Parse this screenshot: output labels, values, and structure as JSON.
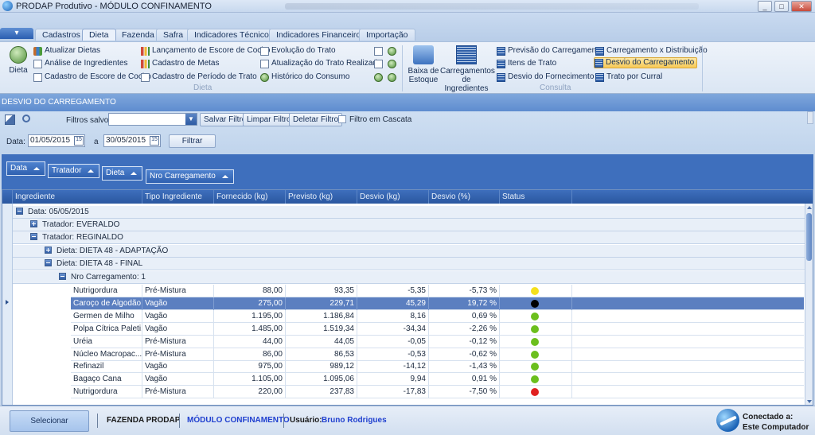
{
  "window": {
    "title": "PRODAP Produtivo - MÓDULO CONFINAMENTO",
    "controls": [
      "_",
      "□",
      "✕"
    ]
  },
  "tabs": [
    "Cadastros",
    "Dieta",
    "Fazenda",
    "Safra",
    "Indicadores Técnicos",
    "Indicadores Financeiros",
    "Importação"
  ],
  "ribbon": {
    "dieta_big": "Dieta",
    "col1": [
      "Atualizar Dietas",
      "Análise de Ingredientes",
      "Cadastro de Escore de Cocho"
    ],
    "col2": [
      "Lançamento de Escore de Cocho",
      "Cadastro de Metas",
      "Cadastro de Período de Trato"
    ],
    "col3": [
      "Evolução do Trato",
      "Atualização do Trato Realizado",
      "Histórico do Consumo"
    ],
    "dieta_group": "Dieta",
    "baixa_estoque": [
      "Baixa de",
      "Estoque"
    ],
    "carregamentos": [
      "Carregamentos",
      "de Ingredientes"
    ],
    "col5": [
      "Previsão do Carregamento",
      "Itens de Trato",
      "Desvio do Fornecimento"
    ],
    "col6": [
      "Carregamento x Distribuição",
      "Desvio do Carregamento",
      "Trato por Curral"
    ],
    "consulta_group": "Consulta"
  },
  "panel_title": "DESVIO DO CARREGAMENTO",
  "filters": {
    "saved_label": "Filtros salvos:",
    "saved_value": "",
    "save_btn": "Salvar Filtro",
    "clear_btn": "Limpar Filtro",
    "delete_btn": "Deletar Filtro",
    "cascade_label": "Filtro em Cascata",
    "date_label": "Data:",
    "date_from": "01/05/2015",
    "date_sep": "a",
    "date_to": "30/05/2015",
    "calendar_glyph": "15",
    "filter_btn": "Filtrar"
  },
  "group_chips": [
    "Data",
    "Tratador",
    "Dieta",
    "Nro Carregamento"
  ],
  "grid": {
    "headers": [
      "Ingrediente",
      "Tipo Ingrediente",
      "Fornecido (kg)",
      "Previsto (kg)",
      "Desvio (kg)",
      "Desvio (%)",
      "Status"
    ],
    "groups": [
      {
        "label": "Data: 05/05/2015"
      },
      {
        "label": "Tratador: EVERALDO"
      },
      {
        "label": "Tratador: REGINALDO"
      },
      {
        "label": "Dieta: DIETA 48 - ADAPTAÇÃO"
      },
      {
        "label": "Dieta: DIETA 48 - FINAL"
      },
      {
        "label": "Nro Carregamento: 1"
      }
    ],
    "rows": [
      {
        "ingrediente": "Nutrigordura",
        "tipo": "Pré-Mistura",
        "fornecido": "88,00",
        "previsto": "93,35",
        "desvio_kg": "-5,35",
        "desvio_pct": "-5,73 %",
        "status": "#f5e01c"
      },
      {
        "ingrediente": "Caroço de Algodão",
        "tipo": "Vagão",
        "fornecido": "275,00",
        "previsto": "229,71",
        "desvio_kg": "45,29",
        "desvio_pct": "19,72 %",
        "status": "#000000"
      },
      {
        "ingrediente": "Germen de Milho",
        "tipo": "Vagão",
        "fornecido": "1.195,00",
        "previsto": "1.186,84",
        "desvio_kg": "8,16",
        "desvio_pct": "0,69 %",
        "status": "#6bbf1d"
      },
      {
        "ingrediente": "Polpa Cítrica Paleti...",
        "tipo": "Vagão",
        "fornecido": "1.485,00",
        "previsto": "1.519,34",
        "desvio_kg": "-34,34",
        "desvio_pct": "-2,26 %",
        "status": "#6bbf1d"
      },
      {
        "ingrediente": "Uréia",
        "tipo": "Pré-Mistura",
        "fornecido": "44,00",
        "previsto": "44,05",
        "desvio_kg": "-0,05",
        "desvio_pct": "-0,12 %",
        "status": "#6bbf1d"
      },
      {
        "ingrediente": "Núcleo Macropac...",
        "tipo": "Pré-Mistura",
        "fornecido": "86,00",
        "previsto": "86,53",
        "desvio_kg": "-0,53",
        "desvio_pct": "-0,62 %",
        "status": "#6bbf1d"
      },
      {
        "ingrediente": "Refinazil",
        "tipo": "Vagão",
        "fornecido": "975,00",
        "previsto": "989,12",
        "desvio_kg": "-14,12",
        "desvio_pct": "-1,43 %",
        "status": "#6bbf1d"
      },
      {
        "ingrediente": "Bagaço Cana",
        "tipo": "Vagão",
        "fornecido": "1.105,00",
        "previsto": "1.095,06",
        "desvio_kg": "9,94",
        "desvio_pct": "0,91 %",
        "status": "#6bbf1d"
      },
      {
        "ingrediente": "Nutrigordura",
        "tipo": "Pré-Mistura",
        "fornecido": "220,00",
        "previsto": "237,83",
        "desvio_kg": "-17,83",
        "desvio_pct": "-7,50 %",
        "status": "#e02020"
      }
    ]
  },
  "statusbar": {
    "select_btn": "Selecionar Localidade",
    "farm": "FAZENDA PRODAP",
    "module": "MÓDULO CONFINAMENTO",
    "user_label": "Usuário:",
    "user_name": "Bruno Rodrigues",
    "connected_label": "Conectado a:",
    "connected_value": "Este Computador"
  },
  "colors": {
    "accent": "#2f61b0",
    "module_text": "#1f3fcf",
    "user_text": "#1f3fcf",
    "selected_row": "#5b7fc0"
  }
}
